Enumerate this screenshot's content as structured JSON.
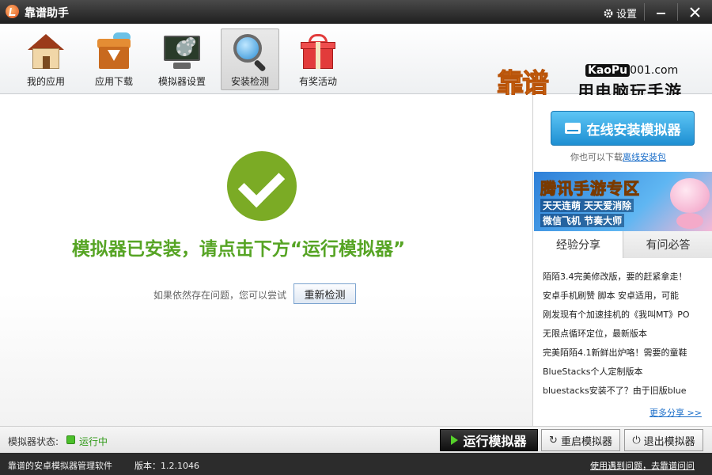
{
  "window": {
    "title": "靠谱助手",
    "settings_label": "设置",
    "settings_icon": "gear-icon",
    "minimize_icon": "minimize-icon",
    "close_icon": "close-icon"
  },
  "toolbar": {
    "items": [
      {
        "label": "我的应用",
        "icon": "house-icon"
      },
      {
        "label": "应用下载",
        "icon": "download-box-icon"
      },
      {
        "label": "模拟器设置",
        "icon": "monitor-gears-icon"
      },
      {
        "label": "安装检测",
        "icon": "magnifier-icon",
        "active": true
      },
      {
        "label": "有奖活动",
        "icon": "gift-icon"
      }
    ]
  },
  "brand": {
    "logo_text": "靠谱",
    "domain_prefix": "KaoPu",
    "domain_suffix": "001.com",
    "slogan": "用电脑玩手游"
  },
  "main": {
    "status_icon": "check-circle-icon",
    "status_message": "模拟器已安装，请点击下方“运行模拟器”",
    "retry_hint": "如果依然存在问题，您可以尝试",
    "retry_button": "重新检测"
  },
  "sidebar": {
    "online_install_button": "在线安装模拟器",
    "offline_text": "你也可以下载",
    "offline_link": "离线安装包",
    "banner": {
      "title": "腾讯手游专区",
      "line1": "天天连萌  天天爱消除",
      "line2": "微信飞机  节奏大师"
    },
    "tabs": [
      {
        "label": "经验分享",
        "active": true
      },
      {
        "label": "有问必答",
        "active": false
      }
    ],
    "news": [
      "陌陌3.4完美修改版，要的赶紧拿走！",
      "安卓手机刷赞 脚本 安卓适用，可能",
      "刚发现有个加速挂机的《我叫MT》PO",
      "无限点循环定位，最新版本",
      "完美陌陌4.1新鲜出炉咯！需要的童鞋",
      "BlueStacks个人定制版本",
      "bluestacks安装不了？由于旧版blue"
    ],
    "more_link": "更多分享 >>"
  },
  "statusbar": {
    "emulator_label": "模拟器状态:",
    "emulator_status": "运行中",
    "status_color": "#4cbf2b",
    "run_button": "运行模拟器",
    "restart_button": "重启模拟器",
    "exit_button": "退出模拟器"
  },
  "footer": {
    "software_text": "靠谱的安卓模拟器管理软件",
    "version_text": "版本：1.2.1046",
    "help_link": "使用遇到问题，去靠谱问问"
  }
}
